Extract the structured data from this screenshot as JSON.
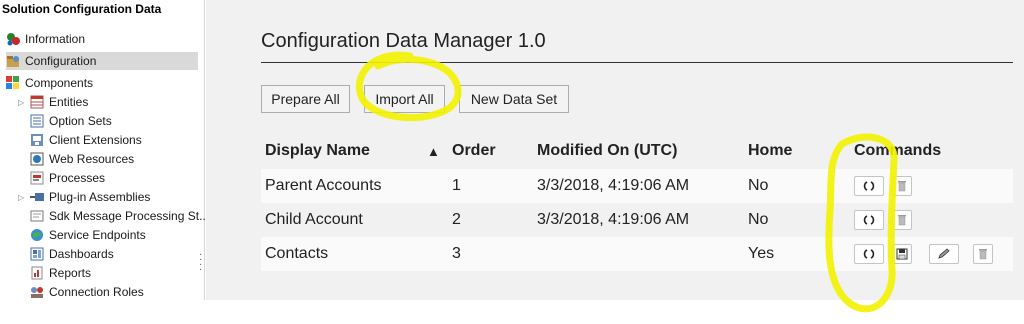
{
  "sidebar": {
    "title": "Solution Configuration Data",
    "items": [
      {
        "label": "Information",
        "icon": "information-icon"
      },
      {
        "label": "Configuration",
        "icon": "configuration-icon",
        "selected": true
      },
      {
        "label": "Components",
        "icon": "components-icon"
      },
      {
        "label": "Entities",
        "icon": "entities-icon",
        "expandable": true
      },
      {
        "label": "Option Sets",
        "icon": "option-sets-icon"
      },
      {
        "label": "Client Extensions",
        "icon": "client-extensions-icon"
      },
      {
        "label": "Web Resources",
        "icon": "web-resources-icon"
      },
      {
        "label": "Processes",
        "icon": "processes-icon"
      },
      {
        "label": "Plug-in Assemblies",
        "icon": "plugin-assemblies-icon",
        "expandable": true
      },
      {
        "label": "Sdk Message Processing St...",
        "icon": "sdk-message-icon"
      },
      {
        "label": "Service Endpoints",
        "icon": "service-endpoints-icon"
      },
      {
        "label": "Dashboards",
        "icon": "dashboards-icon"
      },
      {
        "label": "Reports",
        "icon": "reports-icon"
      },
      {
        "label": "Connection Roles",
        "icon": "connection-roles-icon"
      }
    ]
  },
  "main": {
    "title": "Configuration Data Manager 1.0",
    "buttons": {
      "prepare_all": "Prepare All",
      "import_all": "Import All",
      "new_data_set": "New Data Set"
    },
    "table": {
      "headers": {
        "display_name": "Display Name",
        "sort_indicator": "▲",
        "order": "Order",
        "modified_on": "Modified On (UTC)",
        "home": "Home",
        "commands": "Commands"
      },
      "rows": [
        {
          "display_name": "Parent Accounts",
          "order": "1",
          "modified_on": "3/3/2018, 4:19:06 AM",
          "home": "No",
          "commands": [
            "refresh",
            "delete"
          ]
        },
        {
          "display_name": "Child Account",
          "order": "2",
          "modified_on": "3/3/2018, 4:19:06 AM",
          "home": "No",
          "commands": [
            "refresh",
            "delete"
          ]
        },
        {
          "display_name": "Contacts",
          "order": "3",
          "modified_on": "",
          "home": "Yes",
          "commands": [
            "refresh",
            "save",
            "edit",
            "delete"
          ]
        }
      ]
    }
  },
  "colors": {
    "highlighter": "#f2f200",
    "sidebar_selected": "#d9d9d9",
    "main_background": "#f1f1f1"
  }
}
